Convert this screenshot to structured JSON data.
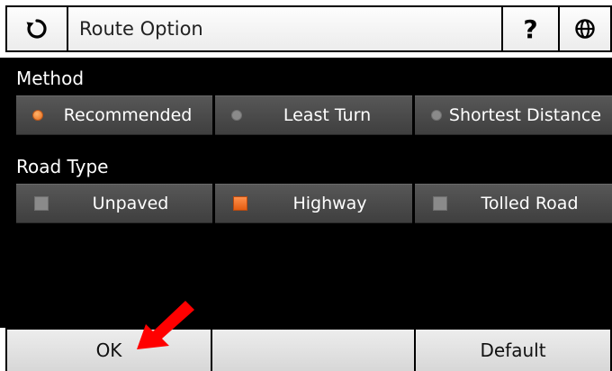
{
  "header": {
    "back_icon": "refresh-back-icon",
    "title": "Route Option",
    "help_label": "?",
    "globe_icon": "globe-icon"
  },
  "method": {
    "label": "Method",
    "options": [
      {
        "label": "Recommended",
        "selected": true
      },
      {
        "label": "Least Turn",
        "selected": false
      },
      {
        "label": "Shortest Distance",
        "selected": false
      }
    ]
  },
  "road_type": {
    "label": "Road Type",
    "options": [
      {
        "label": "Unpaved",
        "checked": false
      },
      {
        "label": "Highway",
        "checked": true
      },
      {
        "label": "Tolled Road",
        "checked": false
      }
    ]
  },
  "footer": {
    "ok_label": "OK",
    "middle_label": "",
    "default_label": "Default"
  },
  "colors": {
    "accent": "#e8701f",
    "annotation_arrow": "#ff0000"
  }
}
